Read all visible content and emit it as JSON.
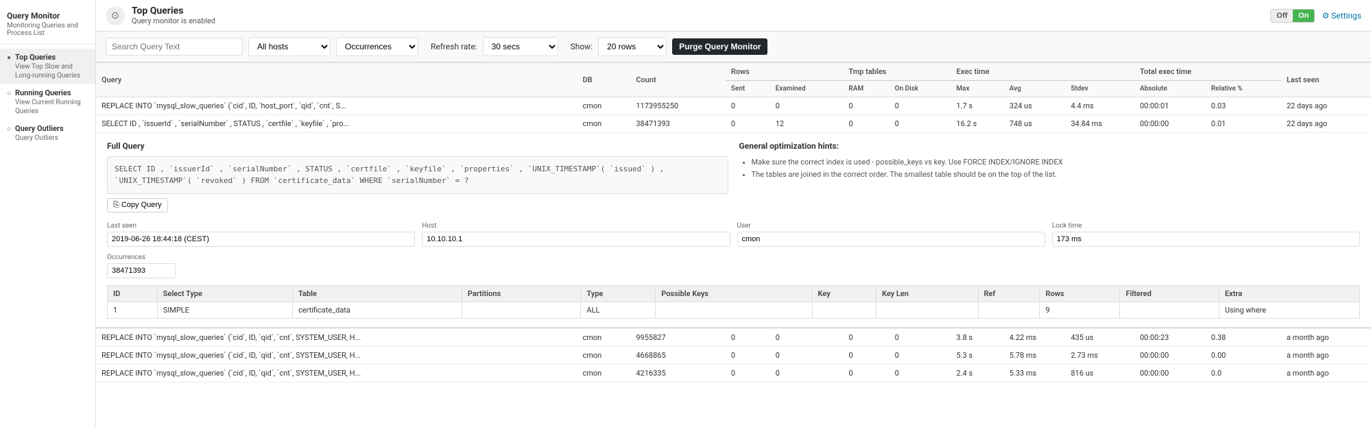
{
  "sidebar": {
    "app_title": "Query Monitor",
    "app_subtitle": "Monitoring Queries and Process List",
    "items": [
      {
        "id": "top-queries",
        "label": "Top Queries",
        "desc": "View Top Slow and Long-running Queries",
        "active": true
      },
      {
        "id": "running-queries",
        "label": "Running Queries",
        "desc": "View Current Running Queries",
        "active": false
      },
      {
        "id": "query-outliers",
        "label": "Query Outliers",
        "desc": "Query Outliers",
        "active": false
      }
    ]
  },
  "topbar": {
    "title": "Top Queries",
    "subtitle": "Query monitor is enabled",
    "toggle_off": "Off",
    "toggle_on": "On",
    "settings_label": "⚙ Settings"
  },
  "toolbar": {
    "search_placeholder": "Search Query Text",
    "hosts_default": "All hosts",
    "sort_default": "Occurrences",
    "refresh_label": "Refresh rate:",
    "refresh_value": "30 secs",
    "show_label": "Show:",
    "show_value": "20 rows",
    "purge_label": "Purge Query Monitor"
  },
  "table": {
    "headers": {
      "query": "Query",
      "db": "DB",
      "count": "Count",
      "rows": "Rows",
      "rows_sent": "Sent",
      "rows_examined": "Examined",
      "tmp_tables": "Tmp tables",
      "tmp_ram": "RAM",
      "tmp_disk": "On Disk",
      "exec_time": "Exec time",
      "exec_max": "Max",
      "exec_avg": "Avg",
      "exec_stdev": "Stdev",
      "total_exec": "Total exec time",
      "total_absolute": "Absolute",
      "total_relative": "Relative %",
      "last_seen": "Last seen"
    },
    "rows": [
      {
        "query": "REPLACE INTO `mysql_slow_queries` (`cid`, ID, `host_port`, `qid`, `cnt`, S...",
        "db": "cmon",
        "count": "1173955250",
        "rows_sent": "0",
        "rows_examined": "0",
        "tmp_ram": "0",
        "tmp_disk": "0",
        "exec_max": "1.7 s",
        "exec_avg": "324 us",
        "exec_stdev": "4.4 ms",
        "total_absolute": "00:00:01",
        "total_relative": "0.03",
        "last_seen": "22 days ago",
        "expanded": false
      },
      {
        "query": "SELECT ID , `issuerId` , `serialNumber` , STATUS , `certfile` , `keyfile` , `pro...",
        "db": "cmon",
        "count": "38471393",
        "rows_sent": "0",
        "rows_examined": "12",
        "tmp_ram": "0",
        "tmp_disk": "0",
        "exec_max": "16.2 s",
        "exec_avg": "748 us",
        "exec_stdev": "34.84 ms",
        "total_absolute": "00:00:00",
        "total_relative": "0.01",
        "last_seen": "22 days ago",
        "expanded": true
      },
      {
        "query": "REPLACE INTO `mysql_slow_queries` (`cid`, ID, `qid`, `cnt`, SYSTEM_USER, H...",
        "db": "cmon",
        "count": "9955827",
        "rows_sent": "0",
        "rows_examined": "0",
        "tmp_ram": "0",
        "tmp_disk": "0",
        "exec_max": "3.8 s",
        "exec_avg": "4.22 ms",
        "exec_stdev": "435 us",
        "total_absolute": "00:00:23",
        "total_relative": "0.38",
        "last_seen": "a month ago",
        "expanded": false
      },
      {
        "query": "REPLACE INTO `mysql_slow_queries` (`cid`, ID, `qid`, `cnt`, SYSTEM_USER, H...",
        "db": "cmon",
        "count": "4668865",
        "rows_sent": "0",
        "rows_examined": "0",
        "tmp_ram": "0",
        "tmp_disk": "0",
        "exec_max": "5.3 s",
        "exec_avg": "5.78 ms",
        "exec_stdev": "2.73 ms",
        "total_absolute": "00:00:00",
        "total_relative": "0.00",
        "last_seen": "a month ago",
        "expanded": false
      },
      {
        "query": "REPLACE INTO `mysql_slow_queries` (`cid`, ID, `qid`, `cnt`, SYSTEM_USER, H...",
        "db": "cmon",
        "count": "4216335",
        "rows_sent": "0",
        "rows_examined": "0",
        "tmp_ram": "0",
        "tmp_disk": "0",
        "exec_max": "2.4 s",
        "exec_avg": "5.33 ms",
        "exec_stdev": "816 us",
        "total_absolute": "00:00:00",
        "total_relative": "0.0",
        "last_seen": "a month ago",
        "expanded": false
      }
    ]
  },
  "expanded": {
    "section_title": "Full Query",
    "query_text": "SELECT ID , `issuerId` , `serialNumber` , STATUS , `certfile` , `keyfile` , `properties` , `UNIX_TIMESTAMP`( `issued` ) , `UNIX_TIMESTAMP`( `revoked` )\nFROM `certificate_data` WHERE `serialNumber` = ?",
    "copy_label": "Copy Query",
    "hints_title": "General optimization hints:",
    "hints": [
      "Make sure the correct index is used - possible_keys vs key. Use FORCE INDEX/IGNORE INDEX",
      "The tables are joined in the correct order. The smallest table should be on the top of the list."
    ],
    "meta": {
      "last_seen_label": "Last seen",
      "last_seen_value": "2019-06-26 18:44:18 (CEST)",
      "host_label": "Host",
      "host_value": "10.10.10.1",
      "user_label": "User",
      "user_value": "cmon",
      "lock_time_label": "Lock time",
      "lock_time_value": "173 ms"
    },
    "occurrences_label": "Occurrences",
    "occurrences_value": "38471393",
    "explain_headers": [
      "ID",
      "Select Type",
      "Table",
      "Partitions",
      "Type",
      "Possible Keys",
      "Key",
      "Key Len",
      "Ref",
      "Rows",
      "Filtered",
      "Extra"
    ],
    "explain_rows": [
      {
        "id": "1",
        "select_type": "SIMPLE",
        "table": "certificate_data",
        "partitions": "",
        "type": "ALL",
        "possible_keys": "",
        "key": "",
        "key_len": "",
        "ref": "",
        "rows": "9",
        "filtered": "",
        "extra": "Using where"
      }
    ]
  }
}
